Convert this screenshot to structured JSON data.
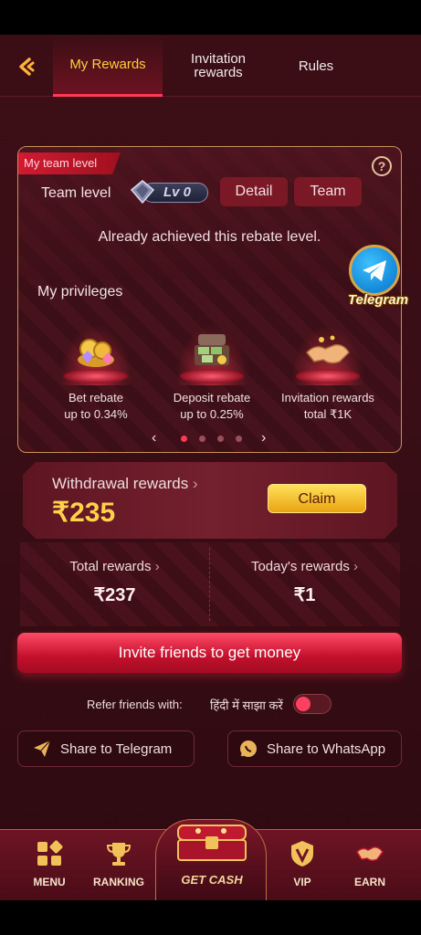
{
  "tabs": [
    {
      "label": "My Rewards",
      "active": true
    },
    {
      "label_line1": "Invitation",
      "label_line2": "rewards",
      "active": false
    },
    {
      "label": "Rules",
      "active": false
    }
  ],
  "team": {
    "ribbon": "My team level",
    "label": "Team level",
    "level": "Lv 0",
    "detail_button": "Detail",
    "team_button": "Team",
    "status": "Already achieved this rebate level."
  },
  "privileges": {
    "title": "My privileges",
    "items": [
      {
        "line1": "Bet rebate",
        "line2": "up to 0.34%",
        "icon": "coins-gems-icon"
      },
      {
        "line1": "Deposit rebate",
        "line2": "up to 0.25%",
        "icon": "money-chest-icon"
      },
      {
        "line1": "Invitation rewards",
        "line2": "total ₹1K",
        "icon": "handshake-icon"
      }
    ],
    "page_count": 4,
    "current_page": 1
  },
  "telegram_float": {
    "label": "Telegram"
  },
  "withdrawal": {
    "title": "Withdrawal rewards",
    "chevron": "›",
    "amount": "₹235",
    "claim_label": "Claim"
  },
  "totals": {
    "total_label": "Total rewards",
    "total_value": "₹237",
    "today_label": "Today's rewards",
    "today_value": "₹1",
    "chevron": "›"
  },
  "invite_button": "Invite friends to get money",
  "refer": {
    "label": "Refer friends with:",
    "language": "हिंदी में साझा करें",
    "toggle_on": false
  },
  "share": {
    "telegram": "Share to Telegram",
    "whatsapp": "Share to WhatsApp"
  },
  "bottom_nav": {
    "menu": "MENU",
    "ranking": "RANKING",
    "get_cash": "GET CASH",
    "vip": "VIP",
    "earn": "EARN"
  },
  "colors": {
    "accent_gold": "#ffd24a",
    "accent_red": "#ff3b54",
    "background": "#3a0e16"
  }
}
